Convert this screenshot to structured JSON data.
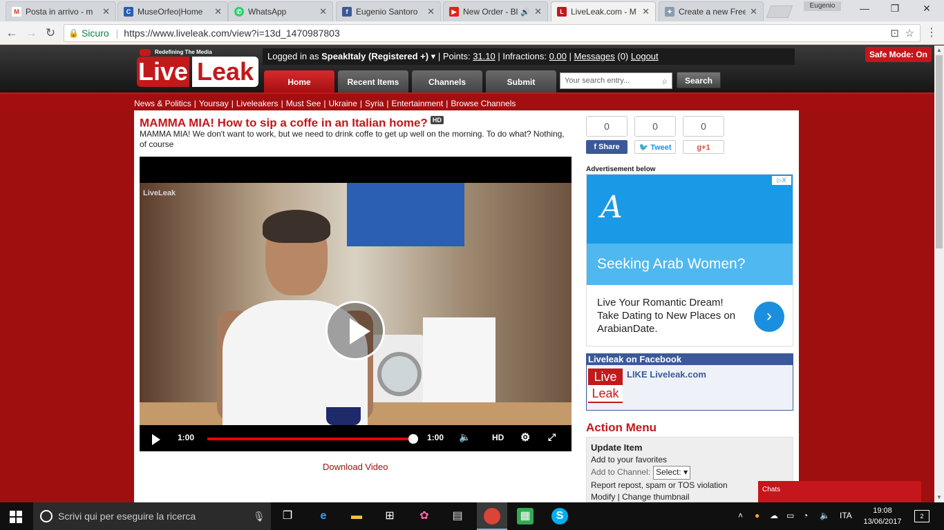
{
  "browser": {
    "tabs": [
      {
        "title": "Posta in arrivo - m",
        "icon": "gmail-icon",
        "color": "#d93025",
        "glyph": "M"
      },
      {
        "title": "MuseOrfeo|Home",
        "icon": "museorfeo-icon",
        "color": "#2b5fb3",
        "glyph": "C"
      },
      {
        "title": "WhatsApp",
        "icon": "whatsapp-icon",
        "color": "#25d366",
        "glyph": "W"
      },
      {
        "title": "Eugenio Santoro",
        "icon": "facebook-icon",
        "color": "#3b5998",
        "glyph": "f"
      },
      {
        "title": "New Order - Bl",
        "icon": "youtube-icon",
        "color": "#e62117",
        "glyph": "▶"
      },
      {
        "title": "LiveLeak.com - M",
        "icon": "liveleak-icon",
        "color": "#c2191b",
        "glyph": "L"
      },
      {
        "title": "Create a new Free",
        "icon": "puzzle-icon",
        "color": "#8a9bb0",
        "glyph": "✦"
      }
    ],
    "profile_name": "Eugenio",
    "secure_label": "Sicuro",
    "url": "https://www.liveleak.com/view?i=13d_1470987803"
  },
  "site": {
    "tagline": "Redefining The Media",
    "logo_live": "Live",
    "logo_leak": "Leak",
    "userbar": {
      "logged_prefix": "Logged in as",
      "username": "SpeakItaly (Registered +)",
      "points_label": "Points:",
      "points_value": "31.10",
      "infractions_label": "Infractions:",
      "infractions_value": "0.00",
      "messages_label": "Messages",
      "messages_count": "(0)",
      "logout_label": "Logout"
    },
    "safe_mode": "Safe Mode: On",
    "nav_tabs": [
      "Home",
      "Recent Items",
      "Channels",
      "Submit"
    ],
    "search_placeholder": "Your search entry...",
    "search_button": "Search",
    "subnav": [
      "News & Politics",
      "Yoursay",
      "Liveleakers",
      "Must See",
      "Ukraine",
      "Syria",
      "Entertainment",
      "Browse Channels"
    ]
  },
  "item": {
    "title": "MAMMA MIA! How to sip a coffe in an Italian home?",
    "hd_badge": "HD",
    "description": "MAMMA MIA! We don't want to work, but we need to drink coffe to get up well on the morning. To do what? Nothing, of course",
    "video": {
      "watermark": "LiveLeak",
      "current_time": "1:00",
      "duration": "1:00",
      "quality": "HD",
      "progress_percent": 100
    },
    "download_label": "Download Video"
  },
  "sidebar": {
    "share": [
      {
        "count": "0",
        "label": "Share",
        "icon": "facebook-icon"
      },
      {
        "count": "0",
        "label": "Tweet",
        "icon": "twitter-icon"
      },
      {
        "count": "0",
        "label": "g+1",
        "icon": "googleplus-icon"
      }
    ],
    "ad_label": "Advertisement below",
    "ad": {
      "logo_glyph": "A",
      "headline": "Seeking Arab Women?",
      "body": "Live Your Romantic Dream! Take Dating to New Places on ArabianDate.",
      "choices": "▷X"
    },
    "facebook_box": {
      "header": "Liveleak on Facebook",
      "like_text": "LIKE Liveleak.com",
      "logo_top": "Live",
      "logo_bottom": "Leak"
    },
    "action_menu": {
      "title": "Action Menu",
      "heading": "Update Item",
      "favorites": "Add to your favorites",
      "channel_label": "Add to Channel:",
      "channel_select": "Select:",
      "report": "Report repost, spam or TOS violation",
      "modify": "Modify",
      "thumbnail": "Change thumbnail"
    }
  },
  "chats_label": "Chats",
  "taskbar": {
    "search_placeholder": "Scrivi qui per eseguire la ricerca",
    "language": "ITA",
    "time": "19:08",
    "date": "13/06/2017",
    "notifications": "2"
  }
}
